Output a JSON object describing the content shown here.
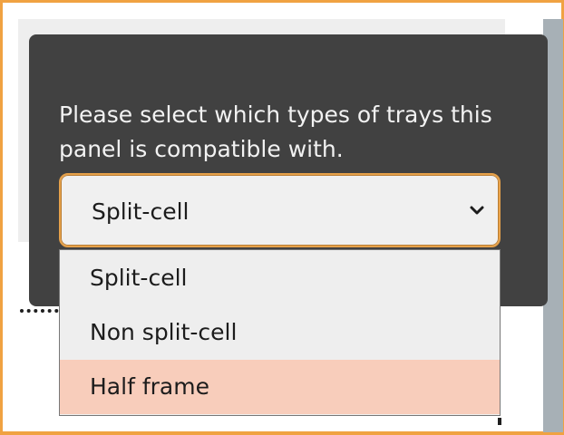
{
  "modal": {
    "prompt": "Please select which types of trays this panel is compatible with."
  },
  "select": {
    "value": "Split-cell",
    "options": [
      "Split-cell",
      "Non split-cell",
      "Half frame"
    ],
    "highlighted": "Half frame"
  },
  "colors": {
    "frame_border": "#f0a242",
    "modal_bg": "#414141",
    "highlight": "#f8cdbb"
  }
}
